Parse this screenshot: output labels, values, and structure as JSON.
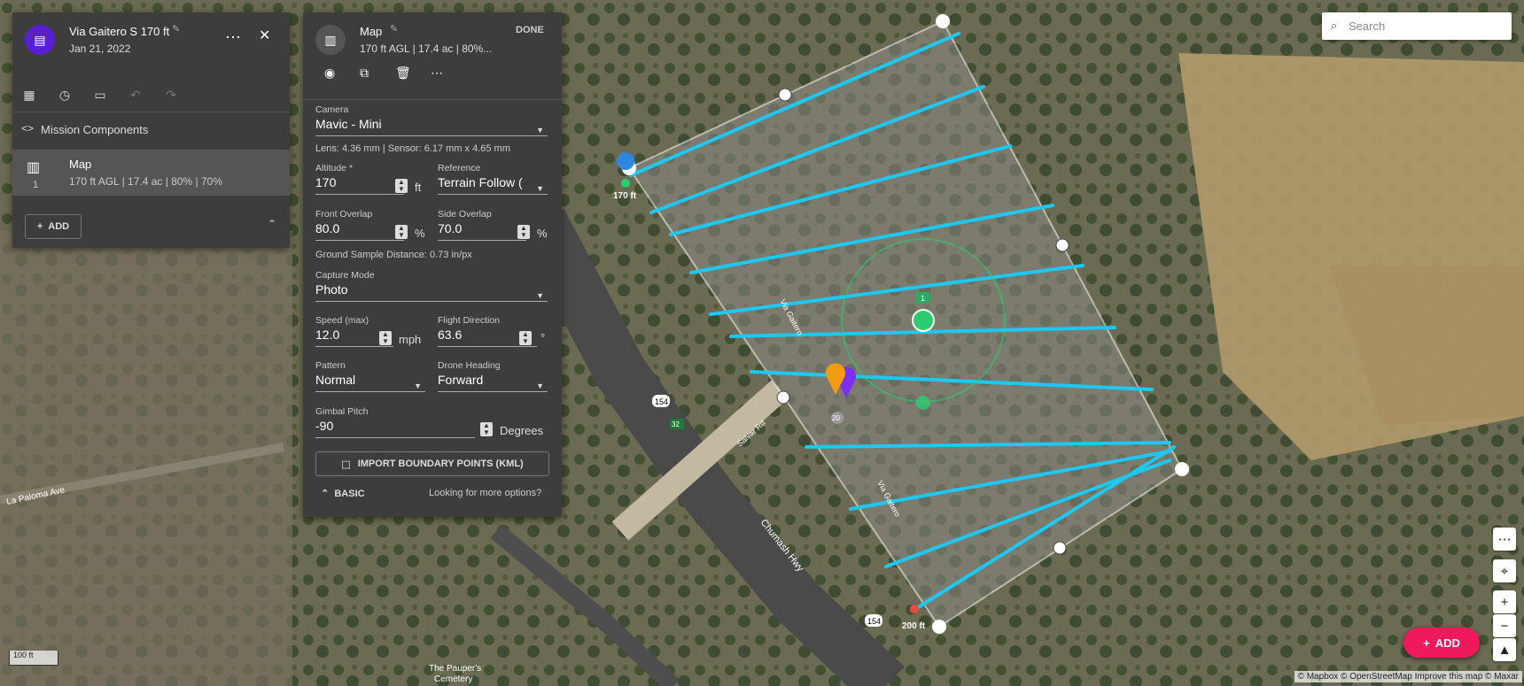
{
  "mission": {
    "title": "Via Gaitero S 170 ft",
    "date": "Jan 21, 2022",
    "components_label": "Mission Components",
    "component": {
      "number": "1",
      "title": "Map",
      "subtitle": "170 ft AGL | 17.4 ac | 80% | 70%"
    },
    "add_label": "ADD"
  },
  "settings": {
    "title": "Map",
    "subtitle": "170 ft AGL | 17.4 ac | 80%...",
    "done_label": "DONE",
    "camera": {
      "label": "Camera",
      "value": "Mavic - Mini"
    },
    "lens_info": "Lens: 4.36 mm | Sensor: 6.17 mm x 4.65 mm",
    "altitude": {
      "label": "Altitude *",
      "value": "170",
      "unit": "ft"
    },
    "reference": {
      "label": "Reference",
      "value": "Terrain Follow ("
    },
    "front_overlap": {
      "label": "Front Overlap",
      "value": "80.0",
      "unit": "%"
    },
    "side_overlap": {
      "label": "Side Overlap",
      "value": "70.0",
      "unit": "%"
    },
    "gsd_info": "Ground Sample Distance: 0.73 in/px",
    "capture_mode": {
      "label": "Capture Mode",
      "value": "Photo"
    },
    "speed": {
      "label": "Speed (max)",
      "value": "12.0",
      "unit": "mph"
    },
    "flight_direction": {
      "label": "Flight Direction",
      "value": "63.6",
      "unit": "°"
    },
    "pattern": {
      "label": "Pattern",
      "value": "Normal"
    },
    "drone_heading": {
      "label": "Drone Heading",
      "value": "Forward"
    },
    "gimbal_pitch": {
      "label": "Gimbal Pitch",
      "value": "-90",
      "unit": "Degrees"
    },
    "import_label": "IMPORT BOUNDARY POINTS (KML)",
    "basic_label": "BASIC",
    "more_options": "Looking for more options?"
  },
  "map": {
    "search_placeholder": "Search",
    "add_label": "ADD",
    "scale": "100 ft",
    "start_alt": "170 ft",
    "end_alt": "200 ft",
    "road_labels": {
      "route_154a": "154",
      "route_154b": "154",
      "route_32": "32",
      "la_paloma": "La Paloma Ave",
      "chumash": "Chumash Hwy",
      "salvar": "Salvar Rd",
      "via_gaitero": "Via Gaitero",
      "via_gaitero2": "Via Gaitero",
      "paupers": "The Pauper's",
      "cemetery": "Cemetery",
      "waypoint_num": "1",
      "home_num": "20"
    },
    "attribution": "© Mapbox © OpenStreetMap Improve this map © Maxar",
    "colors": {
      "flight_path": "#1ec8f5",
      "boundary": "#ffffff",
      "accent": "#f0195b",
      "avatar": "#5a1fd1"
    }
  }
}
